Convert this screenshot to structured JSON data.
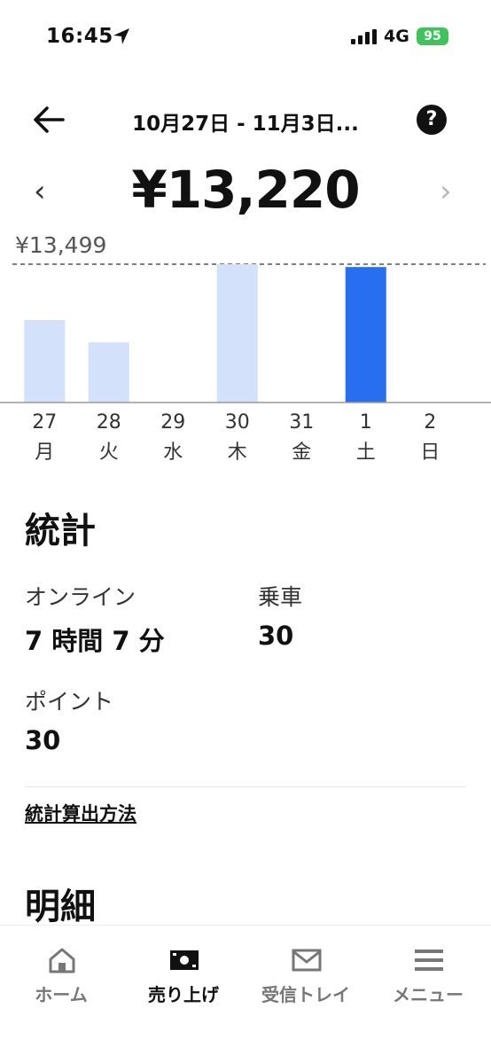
{
  "status_bar": {
    "time": "16:45",
    "network": "4G",
    "battery": "95"
  },
  "header": {
    "title": "10月27日 - 11月3日..."
  },
  "earnings": {
    "total": "¥13,220",
    "prev_glyph": "‹",
    "next_glyph": "›"
  },
  "chart_data": {
    "type": "bar",
    "max_label": "¥13,499",
    "reference_value": 13499,
    "ylim": [
      0,
      13499
    ],
    "categories": [
      "27",
      "28",
      "29",
      "30",
      "31",
      "1",
      "2"
    ],
    "weekdays": [
      "月",
      "火",
      "水",
      "木",
      "金",
      "土",
      "日"
    ],
    "values": [
      8050,
      5860,
      0,
      13499,
      0,
      13220,
      0
    ],
    "selected_index": 5,
    "colors": {
      "bar": "#d3e2fa",
      "selected": "#276ef1",
      "reference": "#555555",
      "axis": "#999999"
    }
  },
  "stats": {
    "title": "統計",
    "online_label": "オンライン",
    "online_value": "7 時間 7 分",
    "rides_label": "乗車",
    "rides_value": "30",
    "points_label": "ポイント",
    "points_value": "30",
    "method_link": "統計算出方法"
  },
  "details": {
    "title": "明細"
  },
  "nav": {
    "items": [
      {
        "label": "ホーム",
        "icon": "home-icon"
      },
      {
        "label": "売り上げ",
        "icon": "earnings-icon"
      },
      {
        "label": "受信トレイ",
        "icon": "inbox-icon"
      },
      {
        "label": "メニュー",
        "icon": "menu-icon"
      }
    ],
    "active_index": 1
  }
}
